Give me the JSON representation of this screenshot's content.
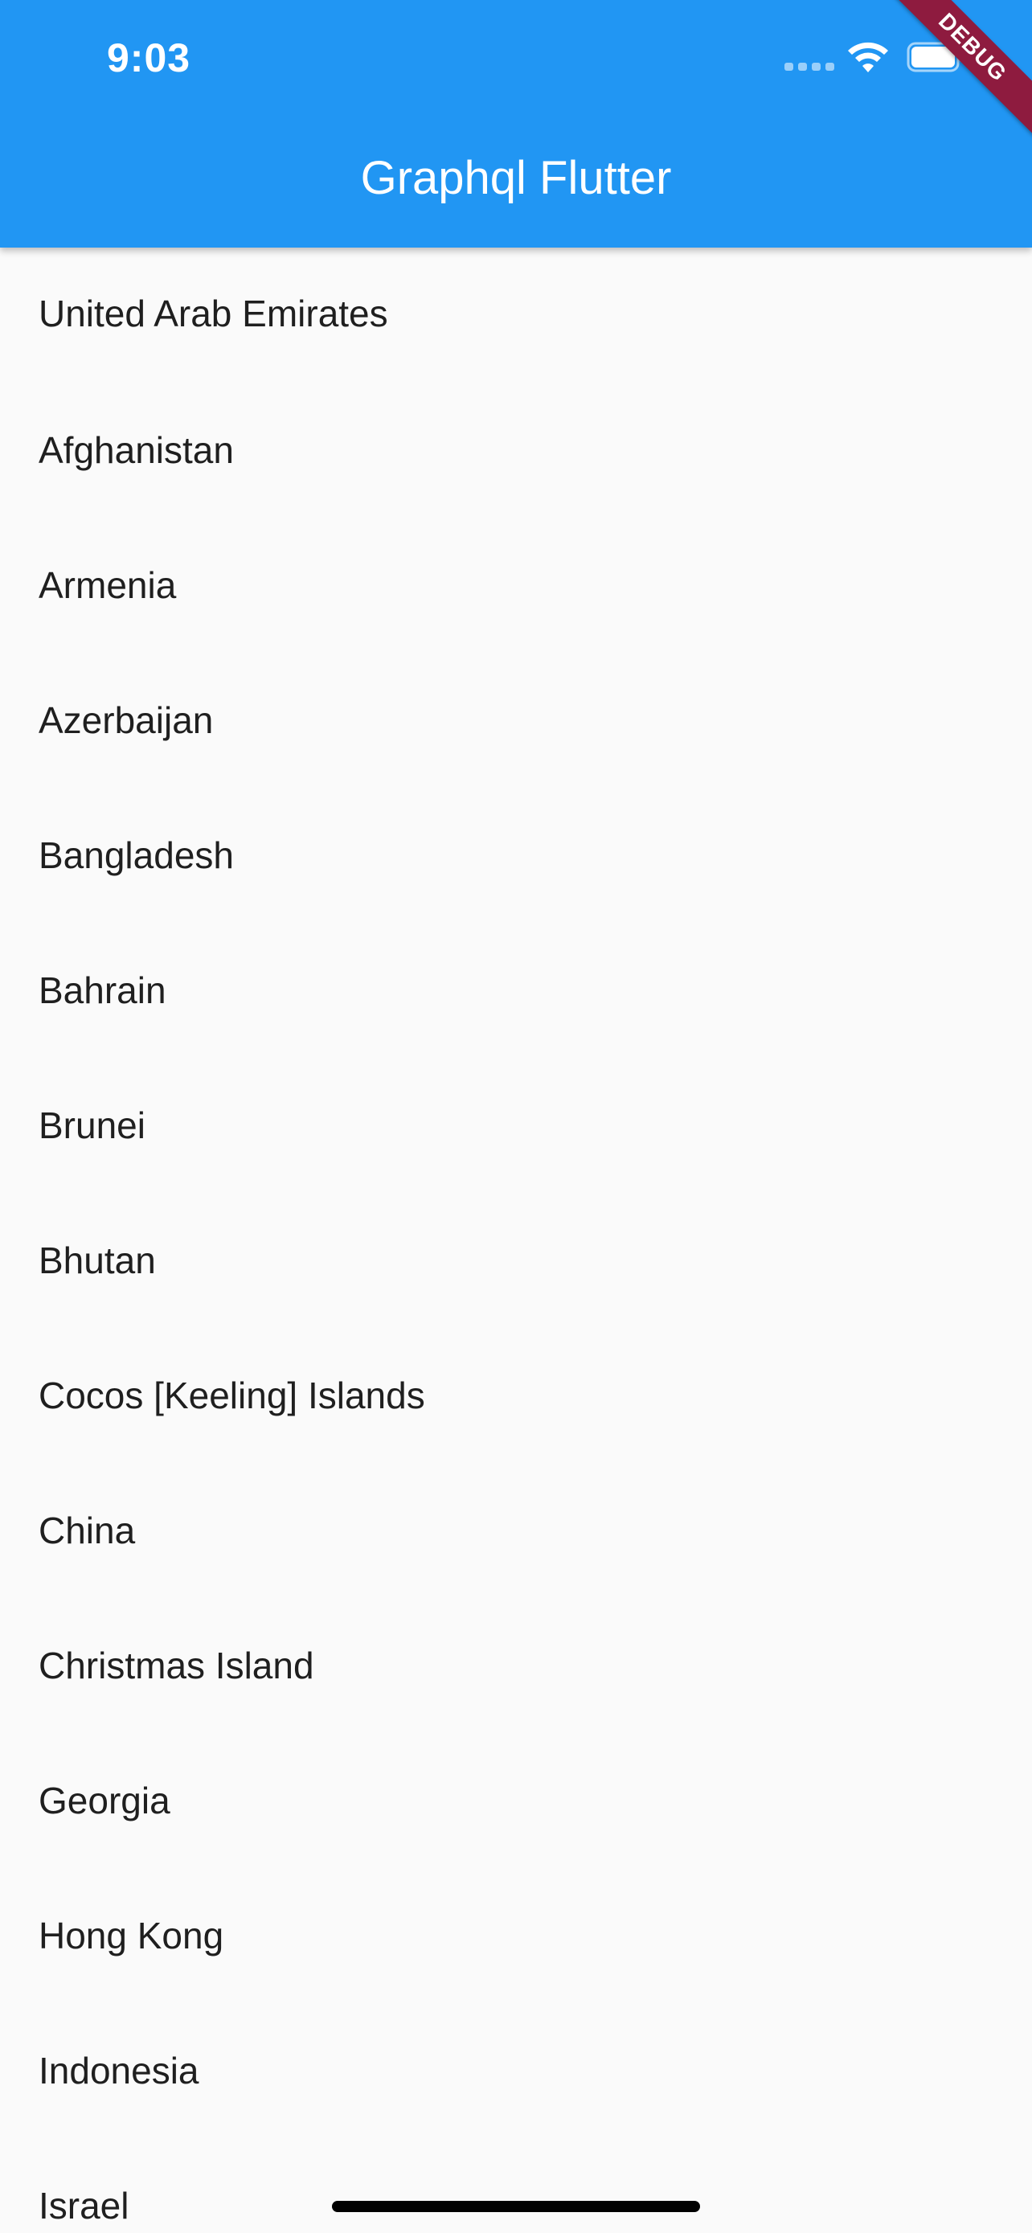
{
  "status_bar": {
    "time": "9:03"
  },
  "app_bar": {
    "title": "Graphql Flutter",
    "background_color": "#2196f3"
  },
  "debug_banner": {
    "label": "DEBUG",
    "color": "#8e1b3f"
  },
  "countries": [
    "United Arab Emirates",
    "Afghanistan",
    "Armenia",
    "Azerbaijan",
    "Bangladesh",
    "Bahrain",
    "Brunei",
    "Bhutan",
    "Cocos [Keeling] Islands",
    "China",
    "Christmas Island",
    "Georgia",
    "Hong Kong",
    "Indonesia",
    "Israel"
  ],
  "icons": {
    "signal": "signal-icon",
    "wifi": "wifi-icon",
    "battery": "battery-icon"
  }
}
